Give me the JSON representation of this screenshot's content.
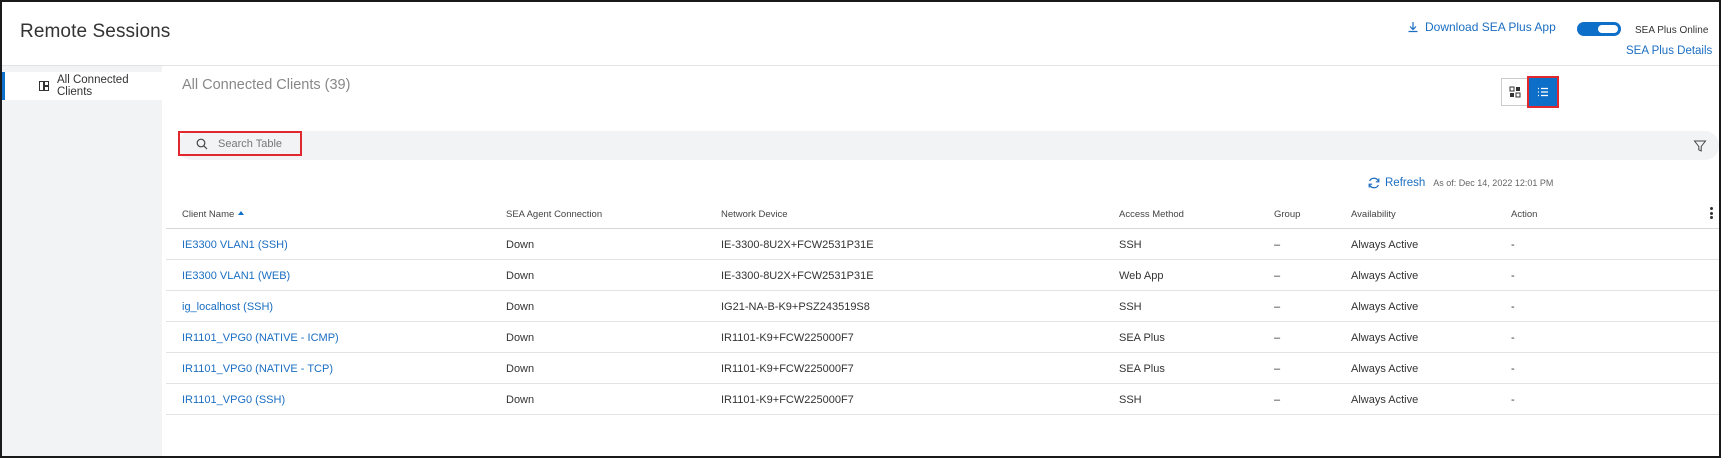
{
  "header": {
    "title": "Remote Sessions",
    "download_label": "Download SEA Plus App",
    "online_label": "SEA Plus Online",
    "details_label": "SEA Plus Details"
  },
  "sidebar": {
    "items": [
      {
        "label": "All Connected Clients",
        "icon": "clients-icon",
        "active": true
      }
    ]
  },
  "main": {
    "title": "All Connected Clients (39)",
    "search_placeholder": "Search Table",
    "refresh_label": "Refresh",
    "as_of": "As of: Dec 14, 2022 12:01 PM"
  },
  "colors": {
    "accent": "#0e6fc9",
    "link": "#1b6ec2",
    "highlight": "#e0282e"
  },
  "table": {
    "columns": [
      "Client Name",
      "SEA Agent Connection",
      "Network Device",
      "Access Method",
      "Group",
      "Availability",
      "Action"
    ],
    "sorted_column": "Client Name",
    "rows": [
      {
        "client": "IE3300 VLAN1 (SSH)",
        "connection": "Down",
        "device": "IE-3300-8U2X+FCW2531P31E",
        "access": "SSH",
        "group": "–",
        "availability": "Always Active",
        "action": "-"
      },
      {
        "client": "IE3300 VLAN1 (WEB)",
        "connection": "Down",
        "device": "IE-3300-8U2X+FCW2531P31E",
        "access": "Web App",
        "group": "–",
        "availability": "Always Active",
        "action": "-"
      },
      {
        "client": "ig_localhost (SSH)",
        "connection": "Down",
        "device": "IG21-NA-B-K9+PSZ243519S8",
        "access": "SSH",
        "group": "–",
        "availability": "Always Active",
        "action": "-"
      },
      {
        "client": "IR1101_VPG0 (NATIVE - ICMP)",
        "connection": "Down",
        "device": "IR1101-K9+FCW225000F7",
        "access": "SEA Plus",
        "group": "–",
        "availability": "Always Active",
        "action": "-"
      },
      {
        "client": "IR1101_VPG0 (NATIVE - TCP)",
        "connection": "Down",
        "device": "IR1101-K9+FCW225000F7",
        "access": "SEA Plus",
        "group": "–",
        "availability": "Always Active",
        "action": "-"
      },
      {
        "client": "IR1101_VPG0 (SSH)",
        "connection": "Down",
        "device": "IR1101-K9+FCW225000F7",
        "access": "SSH",
        "group": "–",
        "availability": "Always Active",
        "action": "-"
      }
    ]
  }
}
